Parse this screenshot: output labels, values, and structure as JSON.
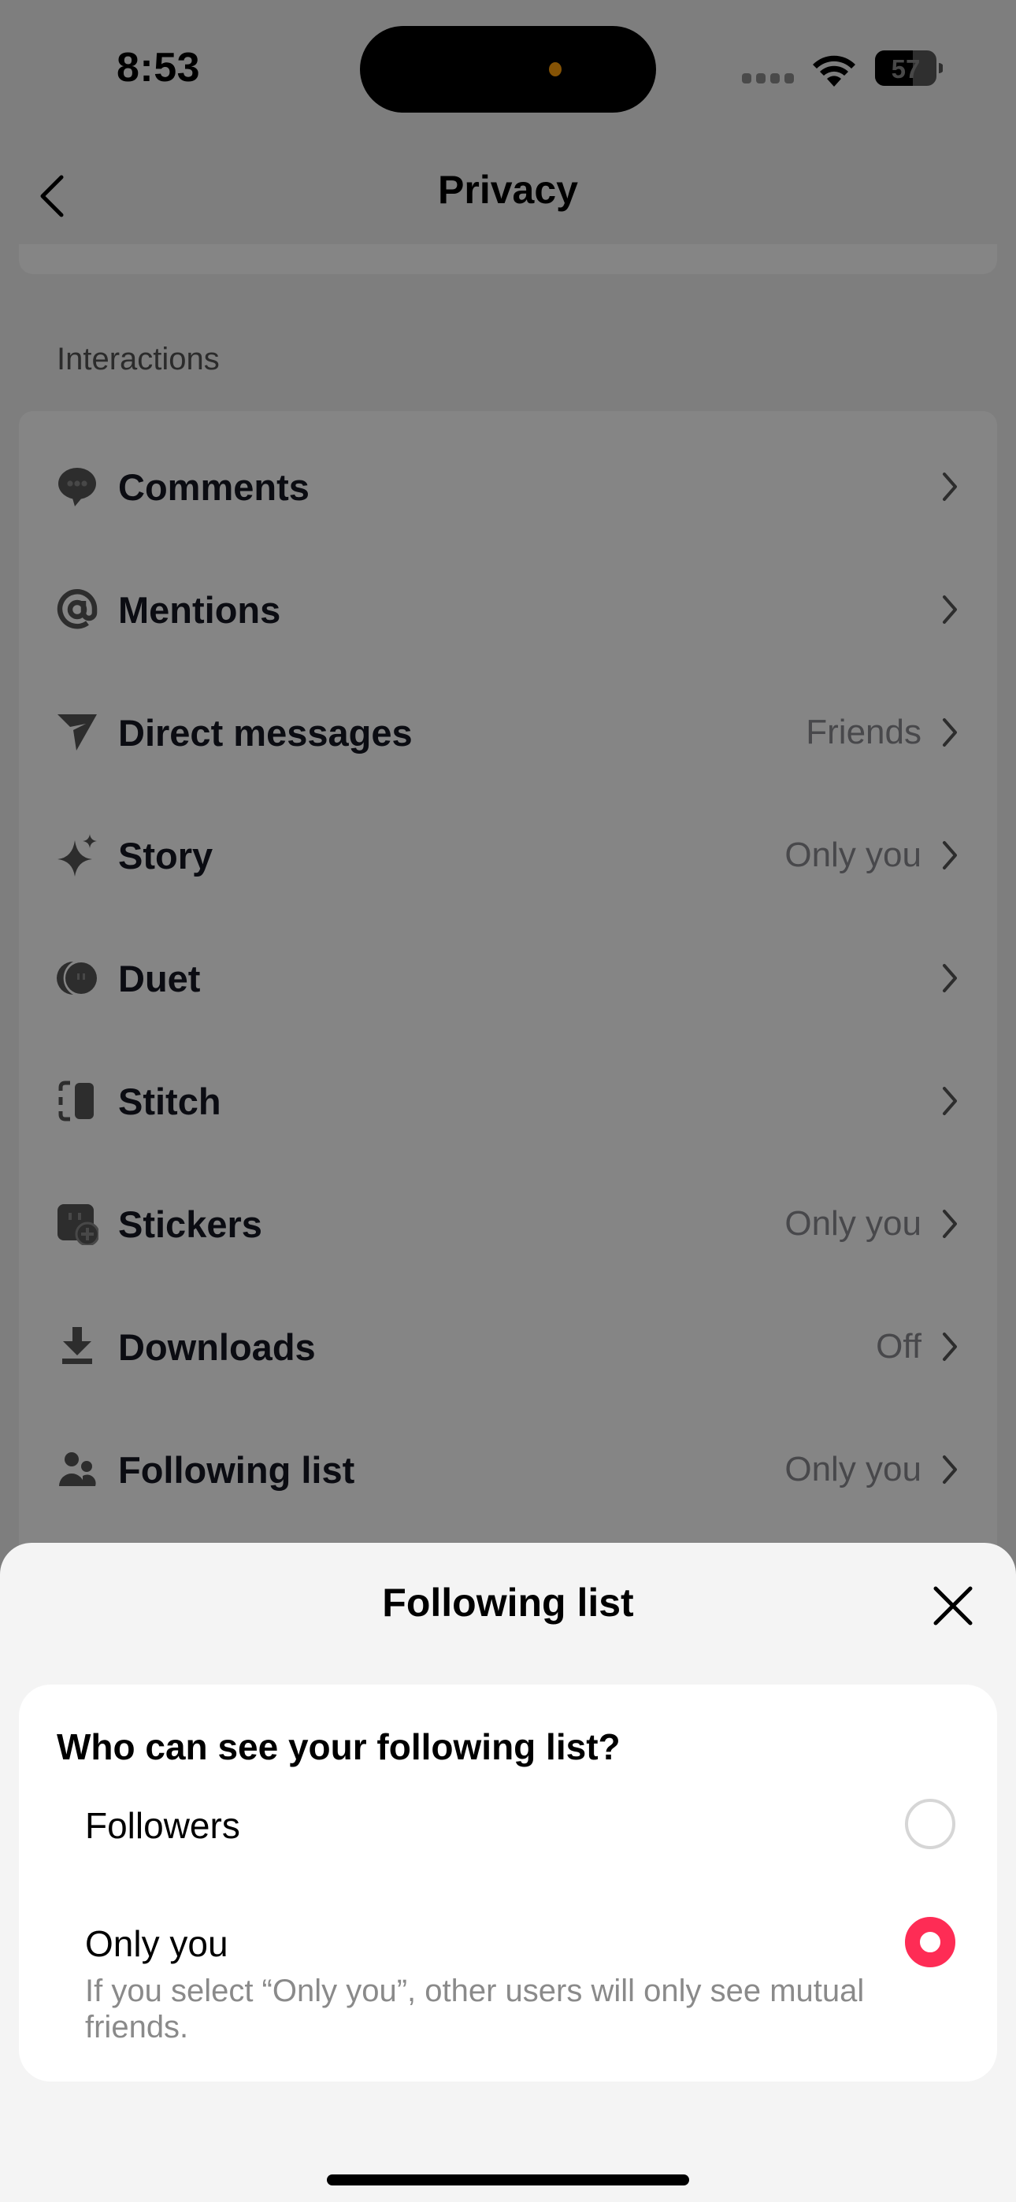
{
  "status_bar": {
    "time": "8:53",
    "battery_level": "57",
    "battery_percent": 57,
    "wifi_icon": "wifi-icon",
    "signal_icon": "cellular-signal-icon"
  },
  "nav": {
    "back_icon": "chevron-left-icon",
    "title": "Privacy"
  },
  "section": {
    "header": "Interactions"
  },
  "items": [
    {
      "label": "Comments",
      "value": "",
      "icon": "comment-bubble-icon"
    },
    {
      "label": "Mentions",
      "value": "",
      "icon": "at-sign-icon"
    },
    {
      "label": "Direct messages",
      "value": "Friends",
      "icon": "send-icon"
    },
    {
      "label": "Story",
      "value": "Only you",
      "icon": "sparkle-icon"
    },
    {
      "label": "Duet",
      "value": "",
      "icon": "duet-icon"
    },
    {
      "label": "Stitch",
      "value": "",
      "icon": "stitch-icon"
    },
    {
      "label": "Stickers",
      "value": "Only you",
      "icon": "sticker-add-icon"
    },
    {
      "label": "Downloads",
      "value": "Off",
      "icon": "download-icon"
    },
    {
      "label": "Following list",
      "value": "Only you",
      "icon": "people-icon"
    }
  ],
  "sheet": {
    "title": "Following list",
    "close_icon": "close-icon",
    "question": "Who can see your following list?",
    "options": [
      {
        "label": "Followers",
        "selected": false,
        "description": ""
      },
      {
        "label": "Only you",
        "selected": true,
        "description": "If you select “Only you”, other users will only see mutual friends."
      }
    ]
  },
  "colors": {
    "accent": "#fe2c55",
    "overlay": "rgba(0,0,0,0.48)",
    "sheet_bg": "#f4f4f4"
  }
}
